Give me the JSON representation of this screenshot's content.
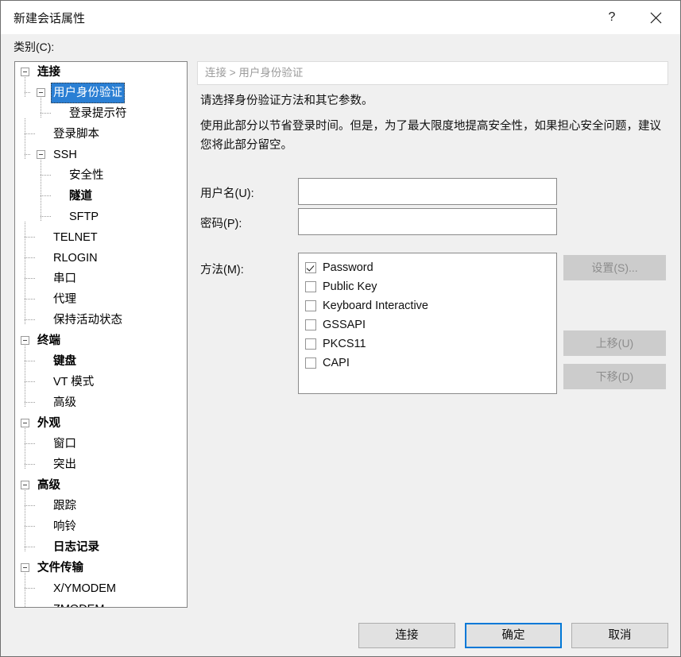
{
  "window": {
    "title": "新建会话属性",
    "help_icon": "question-mark-icon",
    "close_icon": "close-icon"
  },
  "category": {
    "label": "类别(C):",
    "tree": [
      {
        "label": "连接",
        "level": 0,
        "bold": true,
        "expander": "minus",
        "selected": false
      },
      {
        "label": "用户身份验证",
        "level": 1,
        "bold": false,
        "expander": "minus",
        "selected": true
      },
      {
        "label": "登录提示符",
        "level": 2,
        "bold": false,
        "expander": "none",
        "selected": false
      },
      {
        "label": "登录脚本",
        "level": 1,
        "bold": false,
        "expander": "none",
        "selected": false
      },
      {
        "label": "SSH",
        "level": 1,
        "bold": false,
        "expander": "minus",
        "selected": false
      },
      {
        "label": "安全性",
        "level": 2,
        "bold": false,
        "expander": "none",
        "selected": false
      },
      {
        "label": "隧道",
        "level": 2,
        "bold": true,
        "expander": "none",
        "selected": false
      },
      {
        "label": "SFTP",
        "level": 2,
        "bold": false,
        "expander": "none",
        "selected": false
      },
      {
        "label": "TELNET",
        "level": 1,
        "bold": false,
        "expander": "none",
        "selected": false
      },
      {
        "label": "RLOGIN",
        "level": 1,
        "bold": false,
        "expander": "none",
        "selected": false
      },
      {
        "label": "串口",
        "level": 1,
        "bold": false,
        "expander": "none",
        "selected": false
      },
      {
        "label": "代理",
        "level": 1,
        "bold": false,
        "expander": "none",
        "selected": false
      },
      {
        "label": "保持活动状态",
        "level": 1,
        "bold": false,
        "expander": "none",
        "selected": false
      },
      {
        "label": "终端",
        "level": 0,
        "bold": true,
        "expander": "minus",
        "selected": false
      },
      {
        "label": "键盘",
        "level": 1,
        "bold": true,
        "expander": "none",
        "selected": false
      },
      {
        "label": "VT 模式",
        "level": 1,
        "bold": false,
        "expander": "none",
        "selected": false
      },
      {
        "label": "高级",
        "level": 1,
        "bold": false,
        "expander": "none",
        "selected": false
      },
      {
        "label": "外观",
        "level": 0,
        "bold": true,
        "expander": "minus",
        "selected": false
      },
      {
        "label": "窗口",
        "level": 1,
        "bold": false,
        "expander": "none",
        "selected": false
      },
      {
        "label": "突出",
        "level": 1,
        "bold": false,
        "expander": "none",
        "selected": false
      },
      {
        "label": "高级",
        "level": 0,
        "bold": true,
        "expander": "minus",
        "selected": false
      },
      {
        "label": "跟踪",
        "level": 1,
        "bold": false,
        "expander": "none",
        "selected": false
      },
      {
        "label": "响铃",
        "level": 1,
        "bold": false,
        "expander": "none",
        "selected": false
      },
      {
        "label": "日志记录",
        "level": 1,
        "bold": true,
        "expander": "none",
        "selected": false
      },
      {
        "label": "文件传输",
        "level": 0,
        "bold": true,
        "expander": "minus",
        "selected": false
      },
      {
        "label": "X/YMODEM",
        "level": 1,
        "bold": false,
        "expander": "none",
        "selected": false
      },
      {
        "label": "ZMODEM",
        "level": 1,
        "bold": false,
        "expander": "none",
        "selected": false
      }
    ]
  },
  "content": {
    "breadcrumb": "连接 > 用户身份验证",
    "description_line1": "请选择身份验证方法和其它参数。",
    "description_line2": "使用此部分以节省登录时间。但是，为了最大限度地提高安全性，如果担心安全问题，建议您将此部分留空。",
    "username_label": "用户名(U):",
    "username_value": "",
    "username_placeholder": "",
    "password_label": "密码(P):",
    "password_value": "",
    "password_placeholder": "",
    "method_label": "方法(M):",
    "methods": [
      {
        "label": "Password",
        "checked": true
      },
      {
        "label": "Public Key",
        "checked": false
      },
      {
        "label": "Keyboard Interactive",
        "checked": false
      },
      {
        "label": "GSSAPI",
        "checked": false
      },
      {
        "label": "PKCS11",
        "checked": false
      },
      {
        "label": "CAPI",
        "checked": false
      }
    ],
    "side_buttons": {
      "settings": "设置(S)...",
      "move_up": "上移(U)",
      "move_down": "下移(D)"
    }
  },
  "footer": {
    "connect": "连接",
    "ok": "确定",
    "cancel": "取消"
  },
  "colors": {
    "selection_blue": "#2a7fd4",
    "default_button_border": "#0078d7",
    "dialog_bg": "#f0f0f0",
    "disabled_button_bg": "#cccccc"
  }
}
